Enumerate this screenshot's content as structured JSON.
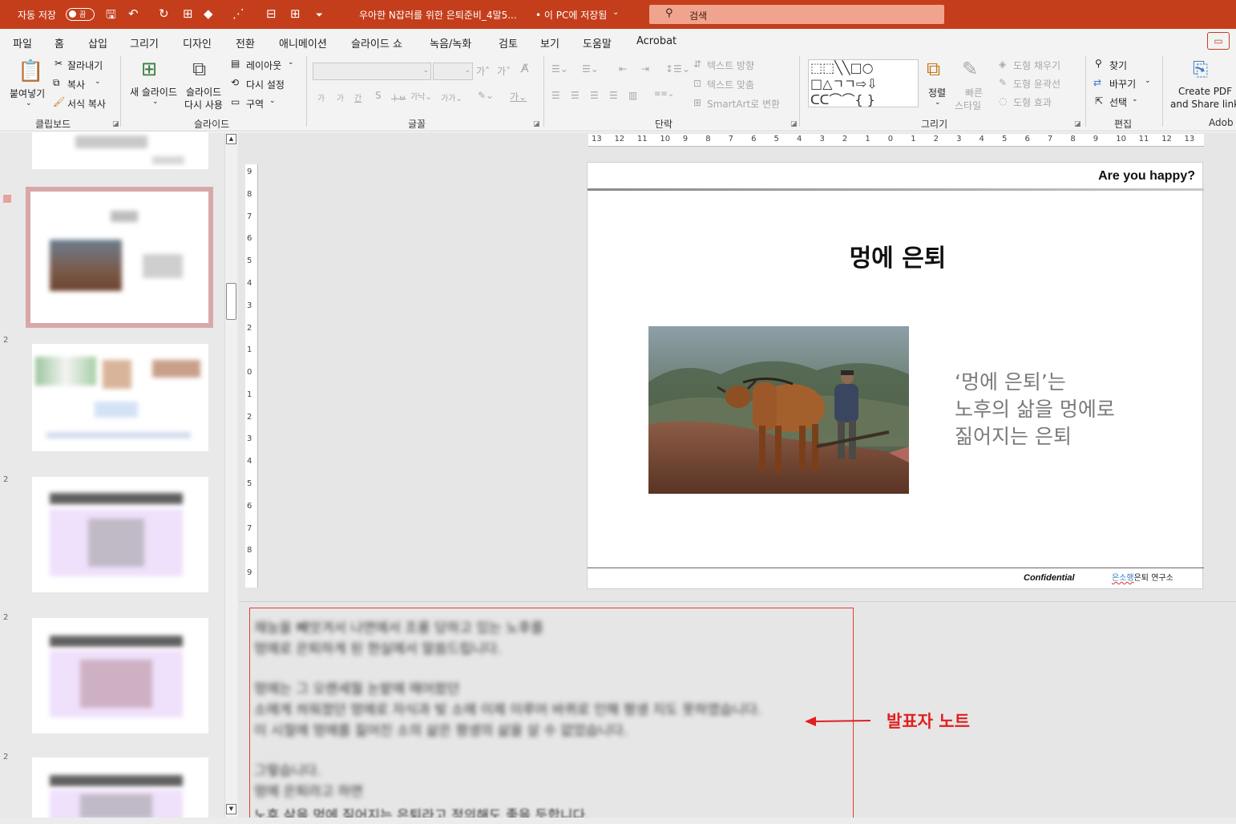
{
  "titlebar": {
    "autosave_label": "자동 저장",
    "autosave_state": "끔",
    "doc_title": "우아한 N잡러를 위한 은퇴준비_4말5...",
    "save_status": "• 이 PC에 저장됨",
    "search_placeholder": "검색"
  },
  "menu": {
    "tabs": [
      "파일",
      "홈",
      "삽입",
      "그리기",
      "디자인",
      "전환",
      "애니메이션",
      "슬라이드 쇼",
      "녹음/녹화",
      "검토",
      "보기",
      "도움말",
      "Acrobat"
    ],
    "active": "홈"
  },
  "ribbon": {
    "clipboard": {
      "paste": "붙여넣기",
      "cut": "잘라내기",
      "copy": "복사",
      "format_painter": "서식 복사",
      "group": "클립보드"
    },
    "slides": {
      "new_slide": "새 슬라이드",
      "reuse_line1": "슬라이드",
      "reuse_line2": "다시 사용",
      "layout": "레이아웃",
      "reset": "다시 설정",
      "section": "구역",
      "group": "슬라이드"
    },
    "font": {
      "group": "글꼴"
    },
    "paragraph": {
      "text_direction": "텍스트 방향",
      "align_text": "텍스트 맞춤",
      "smartart": "SmartArt로 변환",
      "group": "단락"
    },
    "drawing": {
      "arrange": "정렬",
      "quick_styles_line1": "빠른",
      "quick_styles_line2": "스타일",
      "shape_fill": "도형 채우기",
      "shape_outline": "도형 윤곽선",
      "shape_effects": "도형 효과",
      "group": "그리기"
    },
    "editing": {
      "find": "찾기",
      "replace": "바꾸기",
      "select": "선택",
      "group": "편집"
    },
    "adobe": {
      "line1": "Create PDF",
      "line2": "and Share link",
      "group": "Adob"
    }
  },
  "ruler": {
    "horizontal": [
      "13",
      "12",
      "11",
      "10",
      "9",
      "8",
      "7",
      "6",
      "5",
      "4",
      "3",
      "2",
      "1",
      "0",
      "1",
      "2",
      "3",
      "4",
      "5",
      "6",
      "7",
      "8",
      "9",
      "10",
      "11",
      "12",
      "13"
    ],
    "vertical": [
      "9",
      "8",
      "7",
      "6",
      "5",
      "4",
      "3",
      "2",
      "1",
      "0",
      "1",
      "2",
      "3",
      "4",
      "5",
      "6",
      "7",
      "8",
      "9"
    ]
  },
  "slide": {
    "header": "Are you happy?",
    "title": "멍에 은퇴",
    "body": "‘멍에 은퇴’는\n노후의 삶을 멍에로\n짊어지는 은퇴",
    "footer_confidential": "Confidential",
    "footer_brand": "은소행",
    "footer_org": "은퇴 연구소"
  },
  "notes": {
    "lines": [
      "재능을 빼앗겨서 나면에서 조롱 당하고 있는 노후를",
      "멍에로 은퇴하게 된 현실에서 말씀드립니다.",
      "",
      "멍에는 그 오랜세월 논밭에 매어왔던",
      "소에게 씌워졌던 멍에로 자식과 빚 소에 이제 이루어 바퀴로 인해 평생 지도 못하였습니다.",
      "이 시절에 멍에를 짊어진 소의 삶은 평생의 삶을 살 수 없었습니다.",
      "",
      "그렇습니다.",
      "멍에 은퇴라고 하면"
    ],
    "last_line": "노후 삶을 멍에 짊어지는 은퇴라고 정의해도 좋을 듯합니다.",
    "annotation": "발표자 노트"
  },
  "colors": {
    "accent": "#c43e1c",
    "annotation": "#e02020"
  }
}
